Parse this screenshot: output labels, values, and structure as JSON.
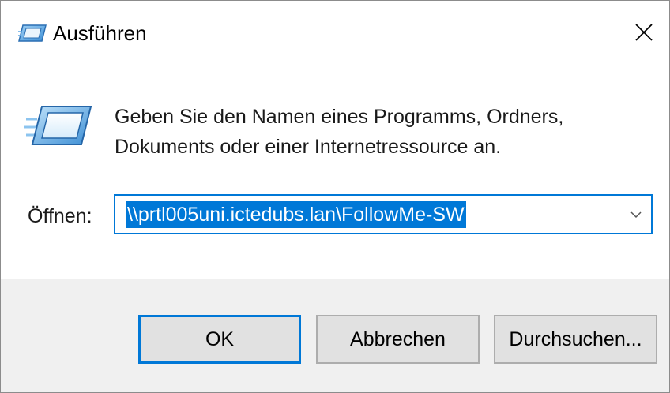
{
  "window": {
    "title": "Ausführen",
    "title_icon": "run-icon",
    "close_icon": "close-icon"
  },
  "content": {
    "description_line1": "Geben Sie den Namen eines Programms, Ordners,",
    "description_line2": "Dokuments oder einer Internetressource an.",
    "open_label": "Öffnen:",
    "open_value": "\\\\prtl005uni.ictedubs.lan\\FollowMe-SW",
    "dropdown_icon": "chevron-down-icon",
    "program_icon": "run-icon"
  },
  "buttons": {
    "ok": "OK",
    "cancel": "Abbrechen",
    "browse": "Durchsuchen..."
  },
  "colors": {
    "accent": "#0078d7",
    "footer_bg": "#f0f0f0",
    "button_bg": "#e1e1e1"
  }
}
